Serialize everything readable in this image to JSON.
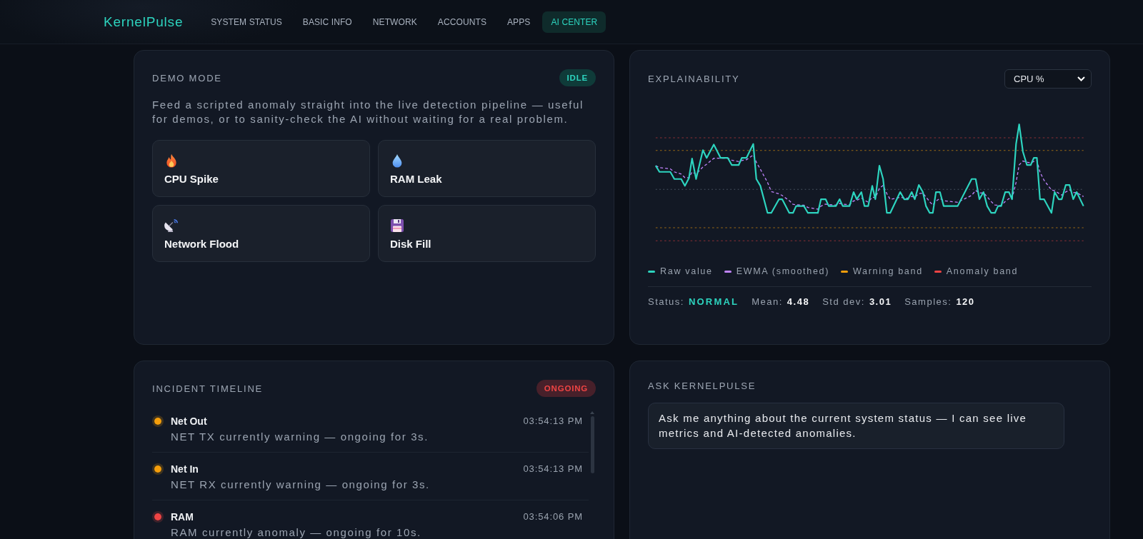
{
  "nav": {
    "logo": "KernelPulse",
    "tabs": [
      {
        "label": "SYSTEM STATUS",
        "selected": false
      },
      {
        "label": "BASIC INFO",
        "selected": false
      },
      {
        "label": "NETWORK",
        "selected": false
      },
      {
        "label": "ACCOUNTS",
        "selected": false
      },
      {
        "label": "APPS",
        "selected": false
      },
      {
        "label": "AI CENTER",
        "selected": true
      }
    ]
  },
  "demo_mode": {
    "title": "DEMO MODE",
    "badge": {
      "label": "IDLE",
      "kind": "idle"
    },
    "description": "Feed a scripted anomaly straight into the live detection pipeline — useful for demos, or to sanity-check the AI without waiting for a real problem.",
    "scenarios": [
      {
        "label": "CPU Spike"
      },
      {
        "label": "RAM Leak"
      },
      {
        "label": "Network Flood"
      },
      {
        "label": "Disk Fill"
      }
    ]
  },
  "explainability": {
    "title": "EXPLAINABILITY",
    "metric_select": {
      "value": "CPU %"
    },
    "legend": [
      {
        "label": "Raw value",
        "color": "#2dd4bf"
      },
      {
        "label": "EWMA (smoothed)",
        "color": "#c084fc"
      },
      {
        "label": "Warning band",
        "color": "#f59e0b"
      },
      {
        "label": "Anomaly band",
        "color": "#ef4444"
      }
    ],
    "status": {
      "label": "Status:",
      "value": "NORMAL"
    },
    "stats": [
      {
        "label": "Mean:",
        "value": "4.48"
      },
      {
        "label": "Std dev:",
        "value": "3.01"
      },
      {
        "label": "Samples:",
        "value": "120"
      }
    ]
  },
  "incident_timeline": {
    "title": "INCIDENT TIMELINE",
    "badge": {
      "label": "ONGOING",
      "kind": "ongoing"
    },
    "items": [
      {
        "title": "Net Out",
        "time": "03:54:13 PM",
        "description": "NET TX currently warning — ongoing for 3s.",
        "color": "#f59e0b"
      },
      {
        "title": "Net In",
        "time": "03:54:13 PM",
        "description": "NET RX currently warning — ongoing for 3s.",
        "color": "#f59e0b"
      },
      {
        "title": "RAM",
        "time": "03:54:06 PM",
        "description": "RAM currently anomaly — ongoing for 10s.",
        "color": "#ef4444"
      }
    ]
  },
  "ask": {
    "title": "ASK KERNELPULSE",
    "message": "Ask me anything about the current system status — I can see live metrics and AI-detected anomalies."
  }
}
